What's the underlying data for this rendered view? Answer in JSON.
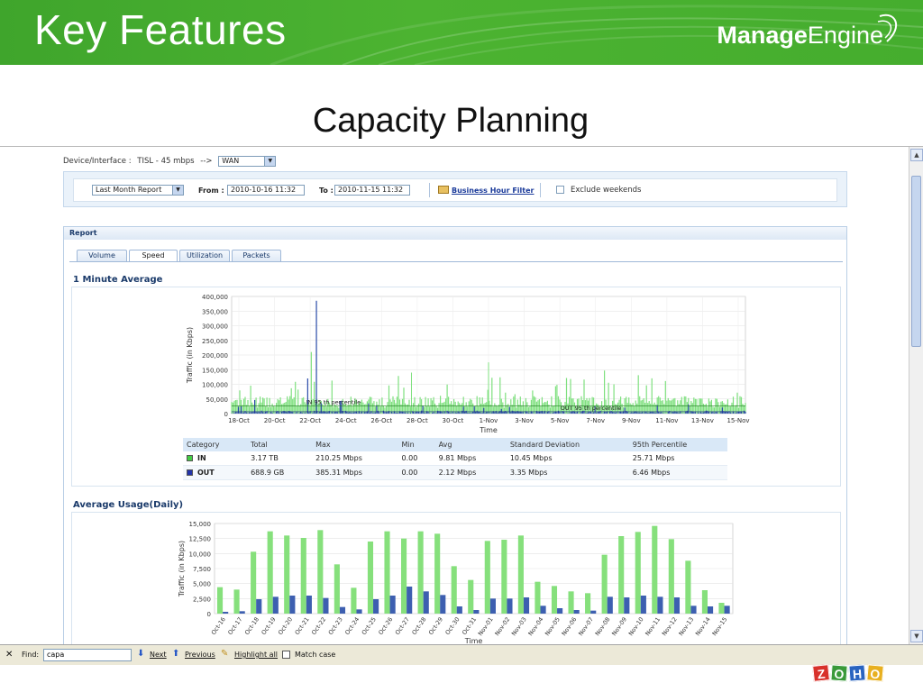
{
  "slide": {
    "title": "Key Features",
    "logo_bold": "Manage",
    "logo_regular": "Engine",
    "subtitle": "Capacity Planning"
  },
  "device": {
    "label": "Device/Interface :",
    "value": "TISL - 45 mbps",
    "arrow": "-->",
    "selected": "WAN"
  },
  "filters": {
    "period": "Last Month Report",
    "from_label": "From :",
    "from_value": "2010-10-16 11:32",
    "to_label": "To :",
    "to_value": "2010-11-15 11:32",
    "business_hour": "Business Hour Filter",
    "exclude_weekends": "Exclude weekends"
  },
  "report": {
    "header": "Report",
    "tabs": [
      "Volume",
      "Speed",
      "Utilization",
      "Packets"
    ],
    "active_tab": "Speed",
    "section1_title": "1 Minute Average",
    "section2_title": "Average Usage(Daily)"
  },
  "stats_table": {
    "columns": [
      "Category",
      "Total",
      "Max",
      "Min",
      "Avg",
      "Standard Deviation",
      "95th Percentile"
    ],
    "rows": [
      {
        "category": "IN",
        "color": "#44cc44",
        "total": "3.17 TB",
        "max": "210.25 Mbps",
        "min": "0.00",
        "avg": "9.81 Mbps",
        "sd": "10.45 Mbps",
        "p95": "25.71 Mbps"
      },
      {
        "category": "OUT",
        "color": "#2233aa",
        "total": "688.9 GB",
        "max": "385.31 Mbps",
        "min": "0.00",
        "avg": "2.12 Mbps",
        "sd": "3.35 Mbps",
        "p95": "6.46 Mbps"
      }
    ]
  },
  "chart_data": [
    {
      "type": "area",
      "xlabel": "Time",
      "ylabel": "Traffic (in Kbps)",
      "ylim": [
        0,
        400000
      ],
      "yticks": [
        "400,000",
        "350,000",
        "300,000",
        "250,000",
        "200,000",
        "150,000",
        "100,000",
        "50,000",
        "0"
      ],
      "xticks": [
        "18-Oct",
        "20-Oct",
        "22-Oct",
        "24-Oct",
        "26-Oct",
        "28-Oct",
        "30-Oct",
        "1-Nov",
        "3-Nov",
        "5-Nov",
        "7-Nov",
        "9-Nov",
        "11-Nov",
        "13-Nov",
        "15-Nov"
      ],
      "annotations": [
        "IN 95 th percentile",
        "OUT 95 th percentile"
      ],
      "series": [
        {
          "name": "IN",
          "color": "#7fe07f",
          "typical_range": [
            20000,
            60000
          ],
          "peak": 210250,
          "p95": 25710
        },
        {
          "name": "OUT",
          "color": "#2a4aa8",
          "typical_range": [
            0,
            10000
          ],
          "peak": 385310,
          "p95": 6460
        }
      ],
      "grid": true
    },
    {
      "type": "bar",
      "xlabel": "Time",
      "ylabel": "Traffic (in Kbps)",
      "ylim": [
        0,
        15000
      ],
      "yticks": [
        "15,000",
        "12,500",
        "10,000",
        "7,500",
        "5,000",
        "2,500",
        "0"
      ],
      "categories": [
        "Oct-16",
        "Oct-17",
        "Oct-18",
        "Oct-19",
        "Oct-20",
        "Oct-21",
        "Oct-22",
        "Oct-23",
        "Oct-24",
        "Oct-25",
        "Oct-26",
        "Oct-27",
        "Oct-28",
        "Oct-29",
        "Oct-30",
        "Oct-31",
        "Nov-01",
        "Nov-02",
        "Nov-03",
        "Nov-04",
        "Nov-05",
        "Nov-06",
        "Nov-07",
        "Nov-08",
        "Nov-09",
        "Nov-10",
        "Nov-11",
        "Nov-12",
        "Nov-13",
        "Nov-14",
        "Nov-15"
      ],
      "series": [
        {
          "name": "IN",
          "color": "#86e07c",
          "values": [
            4400,
            4000,
            10300,
            13700,
            13000,
            12600,
            13900,
            8200,
            4300,
            12000,
            13700,
            12500,
            13700,
            13300,
            7900,
            5600,
            12100,
            12300,
            13000,
            5300,
            4600,
            3700,
            3400,
            9800,
            12900,
            13600,
            14600,
            12400,
            8800,
            3900,
            1800
          ]
        },
        {
          "name": "OUT",
          "color": "#3d5fb0",
          "values": [
            300,
            400,
            2400,
            2800,
            3000,
            3000,
            2600,
            1100,
            700,
            2400,
            3000,
            4500,
            3700,
            3100,
            1200,
            600,
            2500,
            2500,
            2700,
            1300,
            900,
            600,
            500,
            2800,
            2700,
            3000,
            2800,
            2700,
            1300,
            1200,
            1300
          ]
        }
      ],
      "grid": true
    }
  ],
  "findbar": {
    "find_label": "Find:",
    "find_value": "capa",
    "next": "Next",
    "previous": "Previous",
    "highlight_all": "Highlight all",
    "match_case": "Match case"
  },
  "zoho": [
    "Z",
    "O",
    "H",
    "O"
  ],
  "colors": {
    "header_green": "#45ad2e",
    "in_green": "#86e07c",
    "out_blue": "#3d5fb0"
  }
}
